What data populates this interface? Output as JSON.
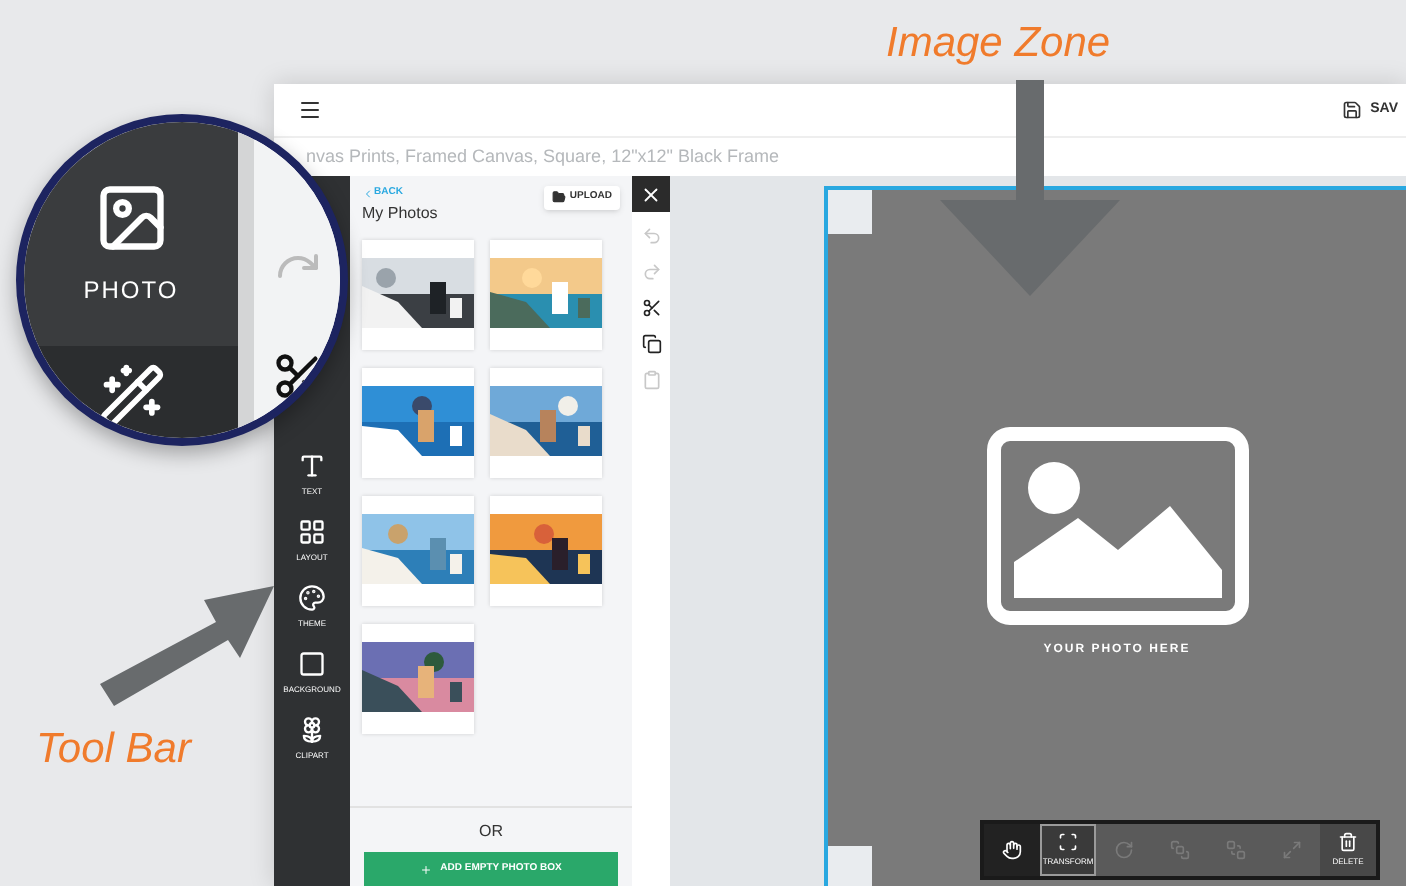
{
  "annotations": [
    {
      "kind": "image_zone",
      "label": "Image Zone"
    },
    {
      "kind": "tool_bar",
      "label": "Tool Bar"
    }
  ],
  "header": {
    "save_label": "SAV"
  },
  "product_title": "nvas Prints, Framed Canvas, Square, 12\"x12\" Black Frame",
  "magnifier": {
    "tool_label": "PHOTO"
  },
  "toolbar": [
    {
      "kind": "text",
      "label": "TEXT"
    },
    {
      "kind": "layout",
      "label": "LAYOUT"
    },
    {
      "kind": "theme",
      "label": "THEME"
    },
    {
      "kind": "background",
      "label": "BACKGROUND"
    },
    {
      "kind": "clipart",
      "label": "CLIPART"
    }
  ],
  "photo_panel": {
    "back": "BACK",
    "title": "My Photos",
    "upload": "UPLOAD",
    "or": "OR",
    "add_button": "ADD EMPTY PHOTO BOX"
  },
  "edit_tools": [
    {
      "kind": "undo",
      "disabled": true
    },
    {
      "kind": "redo",
      "disabled": true
    },
    {
      "kind": "cut",
      "disabled": false
    },
    {
      "kind": "copy",
      "disabled": false
    },
    {
      "kind": "paste",
      "disabled": true
    }
  ],
  "image_zone": {
    "caption": "YOUR PHOTO HERE"
  },
  "bottom_toolbar": [
    {
      "kind": "pan",
      "selected": false,
      "disabled": false
    },
    {
      "kind": "transform",
      "label": "TRANSFORM",
      "selected": true,
      "disabled": false
    },
    {
      "kind": "rotate",
      "selected": false,
      "disabled": true
    },
    {
      "kind": "front",
      "selected": false,
      "disabled": true
    },
    {
      "kind": "back",
      "selected": false,
      "disabled": true
    },
    {
      "kind": "resize",
      "selected": false,
      "disabled": true
    },
    {
      "kind": "delete",
      "label": "DELETE",
      "selected": false,
      "disabled": false
    }
  ]
}
